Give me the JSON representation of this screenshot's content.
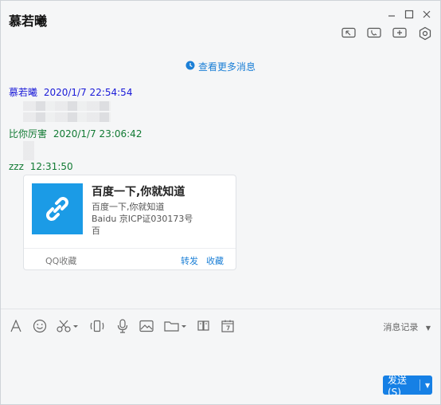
{
  "window": {
    "title": "慕若曦"
  },
  "chat": {
    "more_messages": "查看更多消息",
    "messages": [
      {
        "sender": "慕若曦",
        "time": "2020/1/7 22:54:54",
        "color": "#1a1ad8"
      },
      {
        "sender": "比你厉害",
        "time": "2020/1/7 23:06:42",
        "color": "#117a33"
      },
      {
        "sender": "zzz",
        "time": "12:31:50",
        "color": "#117a33"
      }
    ],
    "card": {
      "title": "百度一下,你就知道",
      "line1": "百度一下,你就知道",
      "line2": "Baidu 京ICP证030173号",
      "line3": "百",
      "source": "QQ收藏",
      "forward": "转发",
      "favorite": "收藏",
      "icon": "link-icon"
    }
  },
  "toolbar": {
    "icons": [
      "font-icon",
      "emoji-icon",
      "scissors-icon",
      "shake-icon",
      "mic-icon",
      "image-icon",
      "folder-icon",
      "sticker-icon",
      "calendar-icon"
    ],
    "history_label": "消息记录"
  },
  "input": {
    "send_label": "发送(S)"
  },
  "colors": {
    "accent": "#1680e5",
    "link_blue": "#1b7fd6",
    "card_thumb": "#1b9be6"
  }
}
